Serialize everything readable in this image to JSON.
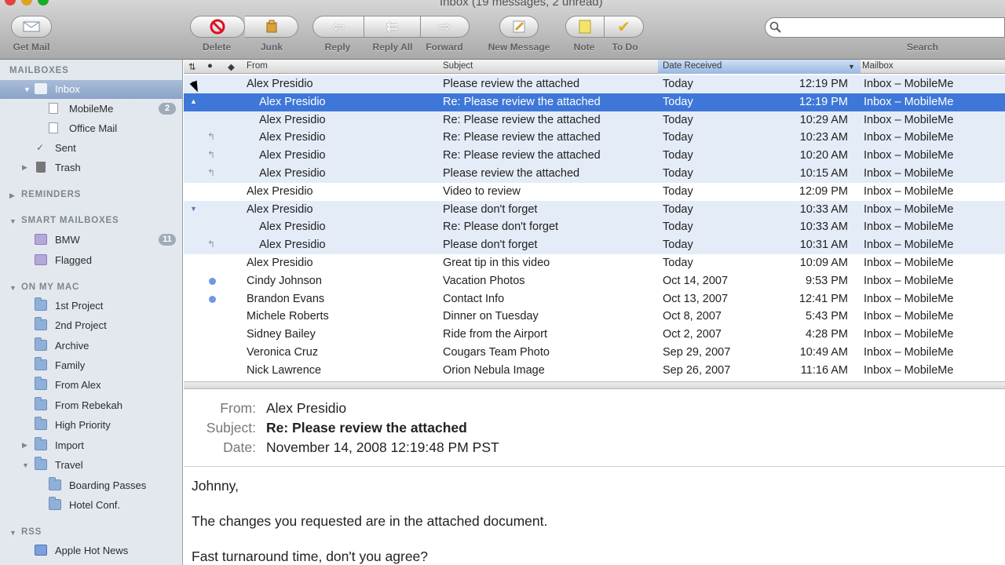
{
  "window": {
    "title": "Inbox (19 messages, 2 unread)"
  },
  "toolbar": {
    "get_mail": "Get Mail",
    "delete": "Delete",
    "junk": "Junk",
    "reply": "Reply",
    "reply_all": "Reply All",
    "forward": "Forward",
    "new_message": "New Message",
    "note": "Note",
    "todo": "To Do",
    "search_label": "Search",
    "search_value": ""
  },
  "sidebar": {
    "mailboxes_header": "MAILBOXES",
    "inbox": "Inbox",
    "mobileme": "MobileMe",
    "mobileme_badge": "2",
    "office_mail": "Office Mail",
    "sent": "Sent",
    "trash": "Trash",
    "reminders_header": "REMINDERS",
    "smart_header": "SMART MAILBOXES",
    "bmw": "BMW",
    "bmw_badge": "11",
    "flagged": "Flagged",
    "onmymac_header": "ON MY MAC",
    "folders": [
      "1st Project",
      "2nd Project",
      "Archive",
      "Family",
      "From Alex",
      "From Rebekah",
      "High Priority",
      "Import",
      "Travel"
    ],
    "subfolders": [
      "Boarding Passes",
      "Hotel Conf."
    ],
    "rss_header": "RSS",
    "apple_hot_news": "Apple Hot News"
  },
  "columns": {
    "from": "From",
    "subject": "Subject",
    "date": "Date Received",
    "mailbox": "Mailbox"
  },
  "messages": [
    {
      "from": "Alex Presidio",
      "subject": "Please review the attached",
      "date": "Today",
      "time": "12:19 PM",
      "mailbox": "Inbox – MobileMe"
    },
    {
      "from": "Alex Presidio",
      "subject": "Re: Please review the attached",
      "date": "Today",
      "time": "12:19 PM",
      "mailbox": "Inbox – MobileMe"
    },
    {
      "from": "Alex Presidio",
      "subject": "Re: Please review the attached",
      "date": "Today",
      "time": "10:29 AM",
      "mailbox": "Inbox – MobileMe"
    },
    {
      "from": "Alex Presidio",
      "subject": "Re: Please review the attached",
      "date": "Today",
      "time": "10:23 AM",
      "mailbox": "Inbox – MobileMe"
    },
    {
      "from": "Alex Presidio",
      "subject": "Re: Please review the attached",
      "date": "Today",
      "time": "10:20 AM",
      "mailbox": "Inbox – MobileMe"
    },
    {
      "from": "Alex Presidio",
      "subject": "Please review the attached",
      "date": "Today",
      "time": "10:15 AM",
      "mailbox": "Inbox – MobileMe"
    },
    {
      "from": "Alex Presidio",
      "subject": "Video to review",
      "date": "Today",
      "time": "12:09 PM",
      "mailbox": "Inbox – MobileMe"
    },
    {
      "from": "Alex Presidio",
      "subject": "Please don't forget",
      "date": "Today",
      "time": "10:33 AM",
      "mailbox": "Inbox – MobileMe"
    },
    {
      "from": "Alex Presidio",
      "subject": "Re: Please don't forget",
      "date": "Today",
      "time": "10:33 AM",
      "mailbox": "Inbox – MobileMe"
    },
    {
      "from": "Alex Presidio",
      "subject": "Please don't forget",
      "date": "Today",
      "time": "10:31 AM",
      "mailbox": "Inbox – MobileMe"
    },
    {
      "from": "Alex Presidio",
      "subject": "Great tip in this video",
      "date": "Today",
      "time": "10:09 AM",
      "mailbox": "Inbox – MobileMe"
    },
    {
      "from": "Cindy Johnson",
      "subject": "Vacation Photos",
      "date": "Oct 14, 2007",
      "time": "9:53 PM",
      "mailbox": "Inbox – MobileMe"
    },
    {
      "from": "Brandon Evans",
      "subject": "Contact Info",
      "date": "Oct 13, 2007",
      "time": "12:41 PM",
      "mailbox": "Inbox – MobileMe"
    },
    {
      "from": "Michele Roberts",
      "subject": "Dinner on Tuesday",
      "date": "Oct 8, 2007",
      "time": "5:43 PM",
      "mailbox": "Inbox – MobileMe"
    },
    {
      "from": "Sidney Bailey",
      "subject": "Ride from the Airport",
      "date": "Oct 2, 2007",
      "time": "4:28 PM",
      "mailbox": "Inbox – MobileMe"
    },
    {
      "from": "Veronica Cruz",
      "subject": "Cougars Team Photo",
      "date": "Sep 29, 2007",
      "time": "10:49 AM",
      "mailbox": "Inbox – MobileMe"
    },
    {
      "from": "Nick Lawrence",
      "subject": "Orion Nebula Image",
      "date": "Sep 26, 2007",
      "time": "11:16 AM",
      "mailbox": "Inbox – MobileMe"
    }
  ],
  "preview": {
    "from_label": "From:",
    "from": "Alex Presidio",
    "subject_label": "Subject:",
    "subject": "Re: Please review the attached",
    "date_label": "Date:",
    "date": "November 14, 2008 12:19:48 PM PST",
    "body": [
      "Johnny,",
      "The changes you requested are in the attached document.",
      "Fast turnaround time, don't you agree?"
    ]
  },
  "colors": {
    "selection": "#3e77d8",
    "thread": "#e4ecf8",
    "sidebar": "#e3e8ef",
    "unread_dot": "#6f98e0"
  }
}
